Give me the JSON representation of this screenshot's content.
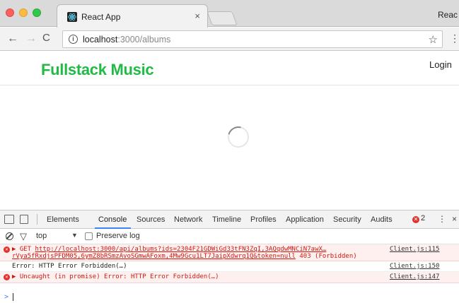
{
  "window": {
    "tab_title": "React App",
    "tab_close": "×",
    "app_label": "Reac"
  },
  "toolbar": {
    "back": "←",
    "forward": "→",
    "reload": "C",
    "info": "i",
    "url_host": "localhost",
    "url_rest": ":3000/albums",
    "star": "☆",
    "menu": "⋮"
  },
  "page": {
    "brand": "Fullstack Music",
    "login": "Login"
  },
  "devtools": {
    "tabs": [
      "Elements",
      "Console",
      "Sources",
      "Network",
      "Timeline",
      "Profiles",
      "Application",
      "Security",
      "Audits"
    ],
    "active_tab": "Console",
    "error_count": "2",
    "more": "⋮",
    "close": "×",
    "filter": {
      "context": "top",
      "context_arrow": "▼",
      "preserve_log": "Preserve log"
    },
    "messages": [
      {
        "type": "error",
        "prefix": "▶ GET ",
        "url_line1": "http://localhost:3000/api/albums?ids=2304F21GDWiGd33tFN3ZqI,3AQqdwMNCiN7awX…",
        "url_line2": "rVya5fRxdjsPFDM05,6ymZ8bRSmzAvoSGmwAFoxm,4Mw9Gcu1LT7JaipXdwrq1Q&token=null",
        "status": " 403 (Forbidden)",
        "source": "Client.js:115"
      },
      {
        "type": "plain",
        "text": "Error: HTTP Error Forbidden(…)",
        "source": "Client.js:150"
      },
      {
        "type": "error",
        "text": "▶ Uncaught (in promise) Error: HTTP Error Forbidden(…)",
        "source": "Client.js:147"
      }
    ],
    "prompt": ">"
  },
  "colors": {
    "brand": "#21ba45",
    "error_text": "#d0180f",
    "error_bg": "#fff0f0",
    "devtools_accent": "#3e82f7"
  }
}
